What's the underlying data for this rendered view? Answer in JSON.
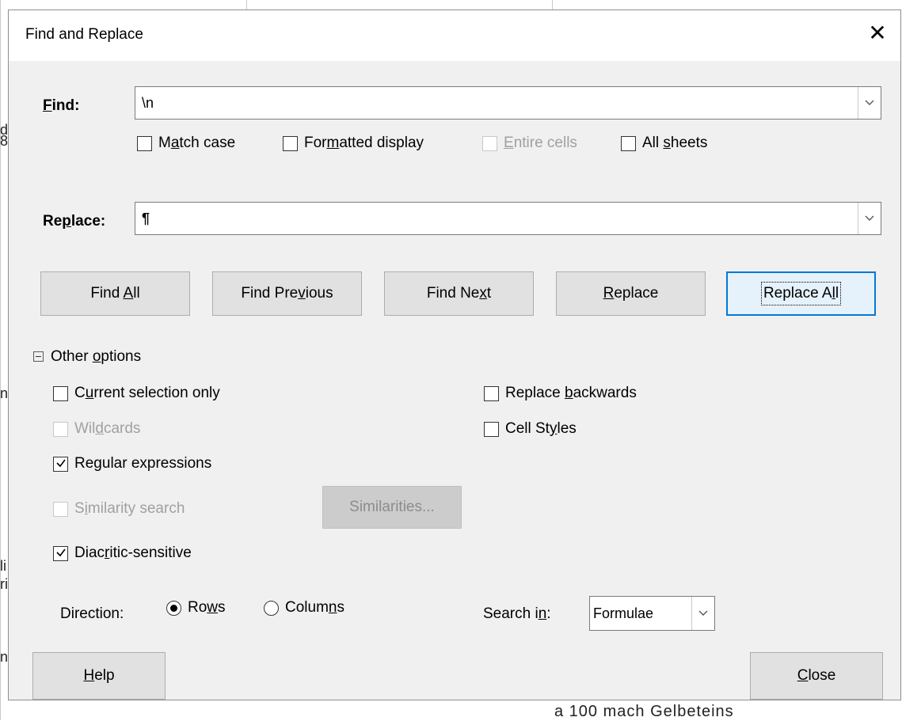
{
  "background": {
    "snippets": [
      "d",
      "n",
      "li",
      "ri",
      "n",
      "8"
    ],
    "bottom_text": "a 100 mach Gelbeteins"
  },
  "dialog": {
    "title": "Find and Replace",
    "close_glyph": "✕"
  },
  "find": {
    "label": "Find:",
    "value": "\\n"
  },
  "replace": {
    "label": "Replace:",
    "value": "¶"
  },
  "find_options": [
    {
      "key": "match_case",
      "label": "Match case",
      "checked": false,
      "enabled": true
    },
    {
      "key": "formatted_display",
      "label": "Formatted display",
      "checked": false,
      "enabled": true
    },
    {
      "key": "entire_cells",
      "label": "Entire cells",
      "checked": false,
      "enabled": false
    },
    {
      "key": "all_sheets",
      "label": "All sheets",
      "checked": false,
      "enabled": true
    }
  ],
  "buttons": {
    "find_all": "Find All",
    "find_previous": "Find Previous",
    "find_next": "Find Next",
    "replace": "Replace",
    "replace_all": "Replace All",
    "similarities": "Similarities...",
    "help": "Help",
    "close": "Close"
  },
  "other_options": {
    "label": "Other options",
    "expanded": true,
    "left": [
      {
        "key": "current_selection",
        "label": "Current selection only",
        "checked": false,
        "enabled": true
      },
      {
        "key": "wildcards",
        "label": "Wildcards",
        "checked": false,
        "enabled": false
      },
      {
        "key": "regular_expressions",
        "label": "Regular expressions",
        "checked": true,
        "enabled": true
      },
      {
        "key": "similarity_search",
        "label": "Similarity search",
        "checked": false,
        "enabled": false
      },
      {
        "key": "diacritic_sensitive",
        "label": "Diacritic-sensitive",
        "checked": true,
        "enabled": true
      }
    ],
    "right": [
      {
        "key": "replace_backwards",
        "label": "Replace backwards",
        "checked": false,
        "enabled": true
      },
      {
        "key": "cell_styles",
        "label": "Cell Styles",
        "checked": false,
        "enabled": true
      }
    ]
  },
  "direction": {
    "label": "Direction:",
    "options": [
      {
        "key": "rows",
        "label": "Rows",
        "selected": true
      },
      {
        "key": "columns",
        "label": "Columns",
        "selected": false
      }
    ]
  },
  "search_in": {
    "label": "Search in:",
    "value": "Formulae"
  },
  "icons": {
    "dropdown": "chevron-down-icon",
    "checkmark": "checkmark-icon",
    "collapse": "collapse-minus-icon",
    "close": "close-icon"
  }
}
